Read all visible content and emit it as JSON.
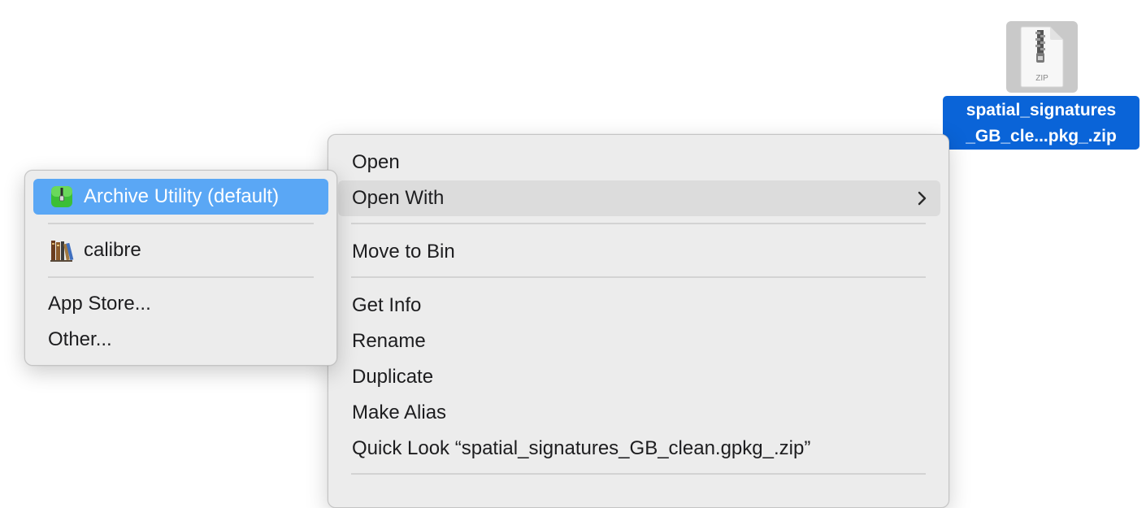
{
  "desktop": {
    "file": {
      "icon_name": "zip-file-icon",
      "icon_text": "ZIP",
      "label_line1": "spatial_signatures",
      "label_line2": "_GB_cle...pkg_.zip",
      "selection_color": "#0a64d8"
    }
  },
  "context_menu": {
    "items": [
      {
        "label": "Open"
      },
      {
        "label": "Open With",
        "has_submenu": true,
        "submenu_icon": "chevron-right-icon"
      },
      {
        "label": "Move to Bin"
      },
      {
        "label": "Get Info"
      },
      {
        "label": "Rename"
      },
      {
        "label": "Duplicate"
      },
      {
        "label": "Make Alias"
      },
      {
        "label": "Quick Look “spatial_signatures_GB_clean.gpkg_.zip”"
      }
    ]
  },
  "open_with_submenu": {
    "items": [
      {
        "label": "Archive Utility (default)",
        "icon": "archive-utility-icon",
        "selected": true
      },
      {
        "label": "calibre",
        "icon": "calibre-books-icon"
      },
      {
        "label": "App Store..."
      },
      {
        "label": "Other..."
      }
    ],
    "highlight_color": "#5aa7f5"
  }
}
